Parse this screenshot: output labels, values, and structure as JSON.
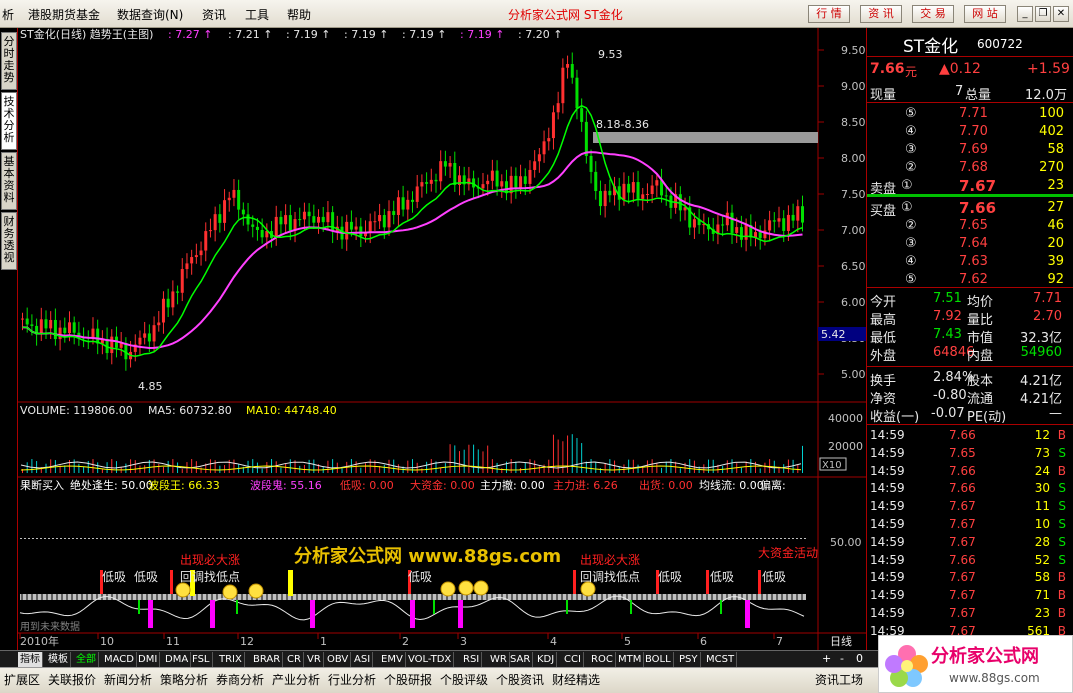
{
  "menu": {
    "items": [
      "析",
      "港股期货基金",
      "数据查询(N)",
      "资讯",
      "工具",
      "帮助"
    ],
    "title": "分析家公式网 ST金化",
    "buttons": [
      "行 情",
      "资 讯",
      "交 易",
      "网 站"
    ]
  },
  "left_tabs": [
    "分时走势",
    "技术分析",
    "基本资料",
    "财务透视"
  ],
  "chart": {
    "main_header": {
      "label": "ST金化(日线) 趋势王(主图)",
      "values": [
        ": 7.27",
        ": 7.21",
        ": 7.19",
        ": 7.19",
        ": 7.19",
        ": 7.19",
        ": 7.20"
      ]
    },
    "price_axis": [
      "9.50",
      "9.00",
      "8.50",
      "8.00",
      "7.50",
      "7.00",
      "6.50",
      "6.00",
      "5.50",
      "5.00"
    ],
    "current_price_tag": "5.42",
    "high_label": "9.53",
    "low_label": "4.85",
    "zone_label": "8.18-8.36",
    "volume_header": {
      "volume": "VOLUME: 119806.00",
      "ma5": "MA5: 60732.80",
      "ma10": "MA10: 44748.40"
    },
    "volume_axis": [
      "40000",
      "20000"
    ],
    "volume_unit": "X10",
    "indicator_header": [
      {
        "text": "果断买入",
        "color": "#ffffff"
      },
      {
        "text": "绝处逢生: 50.00",
        "color": "#ffffff"
      },
      {
        "text": "波段王: 66.33",
        "color": "#ffff00"
      },
      {
        "text": "波段鬼: 55.16",
        "color": "#ff40ff"
      },
      {
        "text": "低吸: 0.00",
        "color": "#ff3030"
      },
      {
        "text": "大资金: 0.00",
        "color": "#ff3030"
      },
      {
        "text": "主力撤: 0.00",
        "color": "#ffffff"
      },
      {
        "text": "主力进: 6.26",
        "color": "#ff3030"
      },
      {
        "text": "出货: 0.00",
        "color": "#ff3030"
      },
      {
        "text": "均线流: 0.00",
        "color": "#ffffff"
      },
      {
        "text": "偏离:",
        "color": "#ffffff"
      }
    ],
    "indicator_axis": "50.00",
    "watermark": "分析家公式网 www.88gs.com",
    "signals": {
      "low_buy": [
        "低吸",
        "低吸",
        "低吸",
        "低吸",
        "低吸",
        "低吸",
        "低吸"
      ],
      "big_rise": [
        "出现必大涨",
        "出现必大涨"
      ],
      "pullback": [
        "回调找低点",
        "回调找低点"
      ],
      "big_fund": "大资金活动"
    },
    "future_data": "用到未来数据",
    "date_axis": [
      "2010年",
      "10",
      "11",
      "12",
      "1",
      "2",
      "3",
      "4",
      "5",
      "6",
      "7"
    ],
    "period": "日线"
  },
  "quote": {
    "name": "ST金化",
    "code": "600722",
    "price": "7.66",
    "price_unit": "元",
    "change": "▲0.12",
    "change_pct": "+1.59",
    "now_label": "现量",
    "now_val": "7",
    "total_label": "总量",
    "total_val": "12.0万",
    "asks": [
      {
        "lvl": "⑤",
        "price": "7.71",
        "vol": "100"
      },
      {
        "lvl": "④",
        "price": "7.70",
        "vol": "402"
      },
      {
        "lvl": "③",
        "price": "7.69",
        "vol": "58"
      },
      {
        "lvl": "②",
        "price": "7.68",
        "vol": "270"
      },
      {
        "lvl": "①",
        "price": "7.67",
        "vol": "23"
      }
    ],
    "sell_label": "卖盘",
    "buy_label": "买盘",
    "bids": [
      {
        "lvl": "①",
        "price": "7.66",
        "vol": "27"
      },
      {
        "lvl": "②",
        "price": "7.65",
        "vol": "46"
      },
      {
        "lvl": "③",
        "price": "7.64",
        "vol": "20"
      },
      {
        "lvl": "④",
        "price": "7.63",
        "vol": "39"
      },
      {
        "lvl": "⑤",
        "price": "7.62",
        "vol": "92"
      }
    ],
    "stats": [
      {
        "l1": "今开",
        "v1": "7.51",
        "c1": "#00e000",
        "l2": "均价",
        "v2": "7.71",
        "c2": "#ff4040"
      },
      {
        "l1": "最高",
        "v1": "7.92",
        "c1": "#ff4040",
        "l2": "量比",
        "v2": "2.70",
        "c2": "#ff4040"
      },
      {
        "l1": "最低",
        "v1": "7.43",
        "c1": "#00e000",
        "l2": "市值",
        "v2": "32.3亿",
        "c2": "#e8e8e8"
      },
      {
        "l1": "外盘",
        "v1": "64846",
        "c1": "#ff4040",
        "l2": "内盘",
        "v2": "54960",
        "c2": "#00e000"
      }
    ],
    "stats2": [
      {
        "l1": "换手",
        "v1": "2.84%",
        "l2": "股本",
        "v2": "4.21亿"
      },
      {
        "l1": "净资",
        "v1": "-0.80",
        "l2": "流通",
        "v2": "4.21亿"
      },
      {
        "l1": "收益(一)",
        "v1": "-0.07",
        "l2": "PE(动)",
        "v2": "—"
      }
    ],
    "ticks": [
      {
        "time": "14:59",
        "price": "7.66",
        "vol": "12",
        "bs": "B"
      },
      {
        "time": "14:59",
        "price": "7.65",
        "vol": "73",
        "bs": "S"
      },
      {
        "time": "14:59",
        "price": "7.66",
        "vol": "24",
        "bs": "B"
      },
      {
        "time": "14:59",
        "price": "7.66",
        "vol": "30",
        "bs": "S"
      },
      {
        "time": "14:59",
        "price": "7.67",
        "vol": "11",
        "bs": "S"
      },
      {
        "time": "14:59",
        "price": "7.67",
        "vol": "10",
        "bs": "S"
      },
      {
        "time": "14:59",
        "price": "7.67",
        "vol": "28",
        "bs": "S"
      },
      {
        "time": "14:59",
        "price": "7.66",
        "vol": "52",
        "bs": "S"
      },
      {
        "time": "14:59",
        "price": "7.67",
        "vol": "58",
        "bs": "B"
      },
      {
        "time": "14:59",
        "price": "7.67",
        "vol": "71",
        "bs": "B"
      },
      {
        "time": "14:59",
        "price": "7.67",
        "vol": "23",
        "bs": "B"
      },
      {
        "time": "14:59",
        "price": "7.67",
        "vol": "561",
        "bs": "B"
      }
    ]
  },
  "bottom_tabs": [
    "指标",
    "模板",
    "全部",
    "MACD",
    "DMI",
    "DMA",
    "FSL",
    "TRIX",
    "BRAR",
    "CR",
    "VR",
    "OBV",
    "ASI",
    "EMV",
    "VOL-TDX",
    "RSI",
    "WR",
    "SAR",
    "KDJ",
    "CCI",
    "ROC",
    "MTM",
    "BOLL",
    "PSY",
    "MCST"
  ],
  "bottom_tabs2": [
    "扩展区",
    "关联报价",
    "新闻分析",
    "策略分析",
    "券商分析",
    "产业分析",
    "行业分析",
    "个股研报",
    "个股评级",
    "个股资讯",
    "财经精选"
  ],
  "info_plaza": "资讯工场",
  "zoom": [
    "+",
    "-",
    "0"
  ],
  "logo": {
    "text": "分析家公式网",
    "url": "www.88gs.com"
  },
  "colors": {
    "up": "#ff3030",
    "down": "#00e000",
    "ma_slow": "#ff40ff",
    "ma_fast": "#00ff00",
    "axis": "#a00000"
  }
}
